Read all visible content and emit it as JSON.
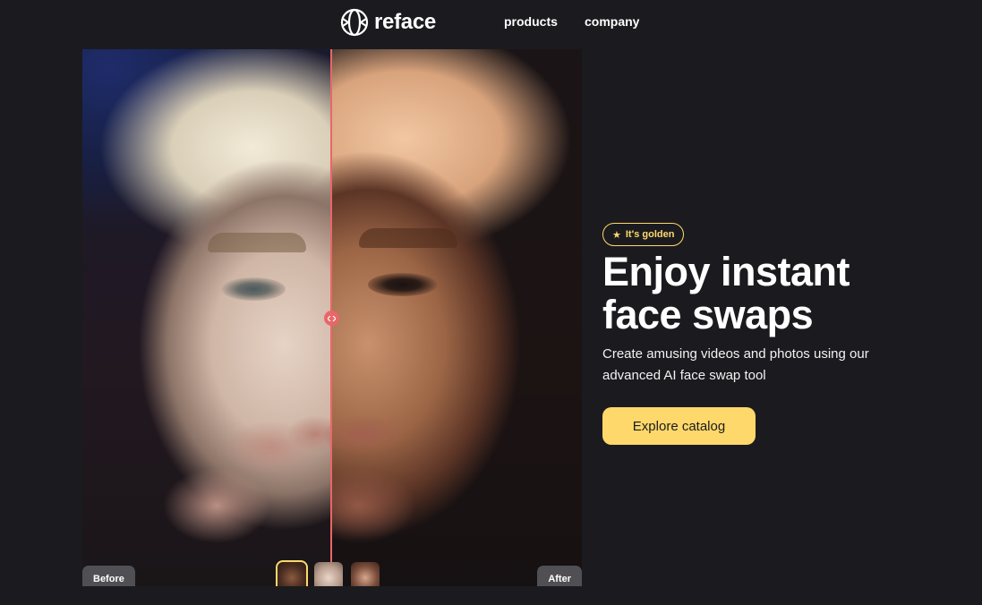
{
  "header": {
    "logo_text": "reface",
    "nav": [
      {
        "label": "products"
      },
      {
        "label": "company"
      }
    ]
  },
  "compare": {
    "before_label": "Before",
    "after_label": "After",
    "handle_icon": "arrows-left-right-icon",
    "divider_color": "#e8676a",
    "thumbnails": [
      {
        "name": "face-thumb-1",
        "active": true
      },
      {
        "name": "face-thumb-2",
        "active": false
      },
      {
        "name": "face-thumb-3",
        "active": false
      }
    ]
  },
  "hero": {
    "badge_icon": "star-icon",
    "badge_text": "It's golden",
    "headline_line1": "Enjoy instant",
    "headline_line2": "face swaps",
    "subtext": "Create amusing videos and photos using our advanced AI face swap tool",
    "cta_label": "Explore catalog"
  },
  "colors": {
    "background": "#1b1b1f",
    "accent": "#ffd86b",
    "text": "#ffffff"
  }
}
